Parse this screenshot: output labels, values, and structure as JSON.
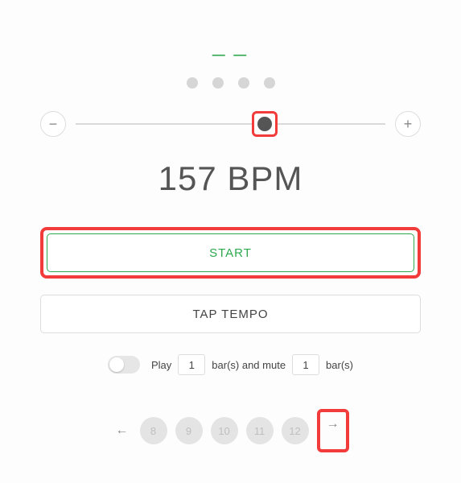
{
  "header": {
    "dashes": "— —"
  },
  "beats": {
    "count": 4
  },
  "slider": {
    "minus": "−",
    "plus": "+",
    "position_pct": 61
  },
  "bpm": {
    "display": "157 BPM",
    "value": 157
  },
  "buttons": {
    "start": "START",
    "tap": "TAP TEMPO"
  },
  "mute": {
    "play_label": "Play",
    "bars_and_mute": "bar(s) and mute",
    "bars_suffix": "bar(s)",
    "play_bars": "1",
    "mute_bars": "1",
    "enabled": false
  },
  "pager": {
    "prev": "←",
    "next": "→",
    "items": [
      "8",
      "9",
      "10",
      "11",
      "12"
    ]
  },
  "highlights": {
    "slider_thumb": true,
    "start_button": true,
    "next_arrow": true
  }
}
